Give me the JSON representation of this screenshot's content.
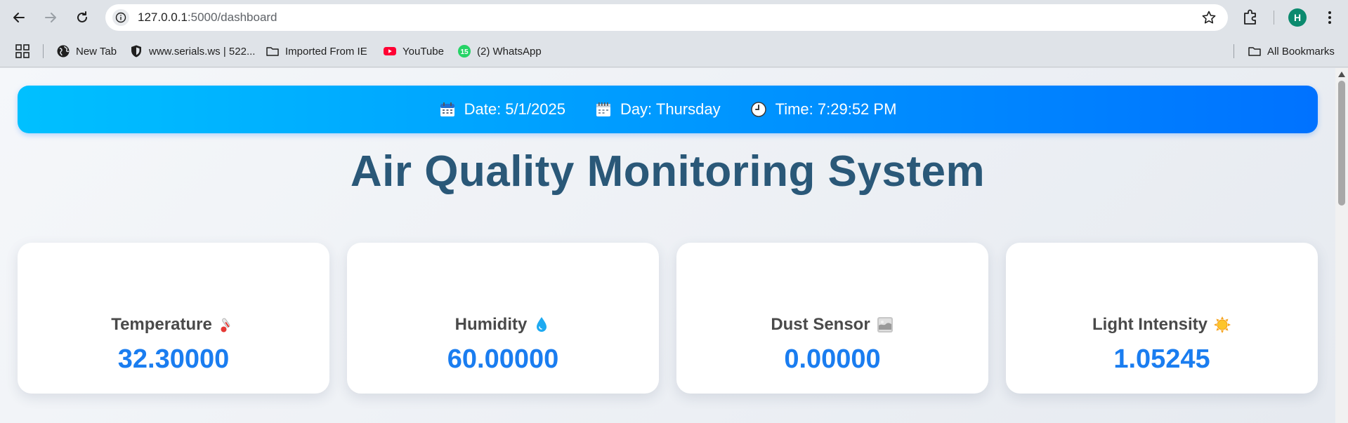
{
  "browser": {
    "url_host": "127.0.0.1",
    "url_path": ":5000/dashboard",
    "profile_initial": "H",
    "bookmarks": [
      {
        "label": "New Tab",
        "icon": "globe-icon"
      },
      {
        "label": "www.serials.ws | 522...",
        "icon": "shield-icon"
      },
      {
        "label": "Imported From IE",
        "icon": "folder-icon"
      },
      {
        "label": "YouTube",
        "icon": "youtube-icon"
      },
      {
        "label": "(2) WhatsApp",
        "icon": "whatsapp-icon",
        "badge": "15"
      }
    ],
    "all_bookmarks_label": "All Bookmarks"
  },
  "header": {
    "date": "Date: 5/1/2025",
    "day": "Day: Thursday",
    "time": "Time: 7:29:52 PM"
  },
  "title": "Air Quality Monitoring System",
  "cards": [
    {
      "label": "Temperature",
      "icon": "thermometer-icon",
      "value": "32.30000"
    },
    {
      "label": "Humidity",
      "icon": "droplet-icon",
      "value": "60.00000"
    },
    {
      "label": "Dust Sensor",
      "icon": "dust-icon",
      "value": "0.00000"
    },
    {
      "label": "Light Intensity",
      "icon": "sun-icon",
      "value": "1.05245"
    }
  ],
  "colors": {
    "header_gradient_start": "#00c0ff",
    "header_gradient_end": "#0072ff",
    "title": "#2a5878",
    "value": "#1a7df0"
  }
}
